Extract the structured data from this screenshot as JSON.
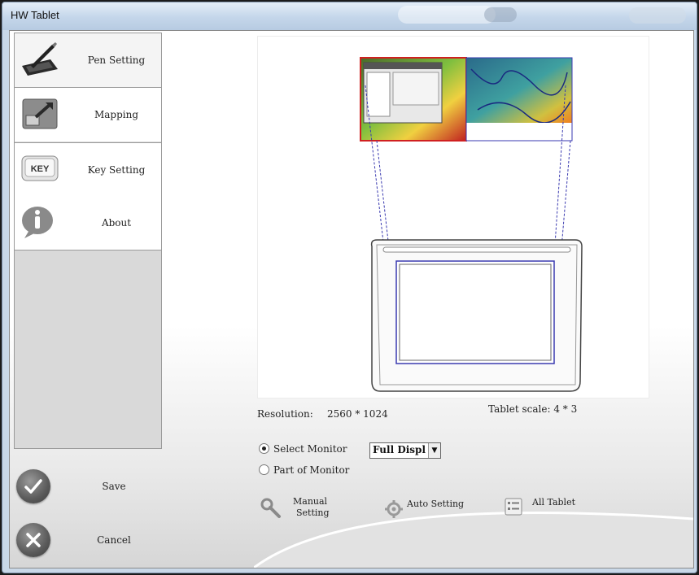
{
  "window": {
    "title": "HW Tablet"
  },
  "sidebar": {
    "items": [
      {
        "label": "Pen Setting",
        "icon": "pen-tablet-icon"
      },
      {
        "label": "Mapping",
        "icon": "mapping-icon"
      },
      {
        "label": "Key Setting",
        "icon": "key-icon"
      },
      {
        "label": "About",
        "icon": "info-icon"
      }
    ]
  },
  "actions": {
    "save": "Save",
    "cancel": "Cancel"
  },
  "mapping": {
    "resolution_label": "Resolution:",
    "resolution_value": "2560 * 1024",
    "tablet_scale": "Tablet scale: 4 * 3",
    "select_monitor": "Select Monitor",
    "part_of_monitor": "Part of Monitor",
    "monitor_option": "Full Displ",
    "manual_setting_line1": "Manual",
    "manual_setting_line2": "Setting",
    "auto_setting": "Auto Setting",
    "all_tablet": "All Tablet"
  },
  "colors": {
    "mapping_line": "#3a3ab0",
    "selected_monitor_border": "#d02020"
  }
}
